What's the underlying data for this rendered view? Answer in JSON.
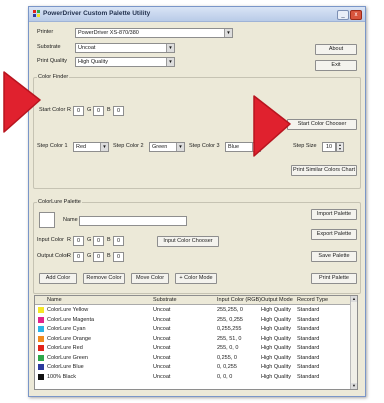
{
  "window": {
    "title": "PowerDriver Custom Palette Utility",
    "buttons": {
      "minimize": "_",
      "close": "x"
    }
  },
  "top": {
    "printer_label": "Printer",
    "printer_value": "PowerDriver XS-870/380",
    "substrate_label": "Substrate",
    "substrate_value": "Uncoat",
    "print_quality_label": "Print Quality",
    "print_quality_value": "High Quality",
    "about_button": "About",
    "exit_button": "Exit"
  },
  "color_finder": {
    "group_label": "Color Finder",
    "start_color_label": "Start Color",
    "r_label": "R",
    "g_label": "G",
    "b_label": "B",
    "start_r": "0",
    "start_g": "0",
    "start_b": "0",
    "start_chooser_button": "Start Color Chooser",
    "step1_label": "Step Color 1",
    "step1_value": "Red",
    "step2_label": "Step Color 2",
    "step2_value": "Green",
    "step3_label": "Step Color 3",
    "step3_value": "Blue",
    "step_size_label": "Step Size",
    "step_size_value": "10",
    "print_similar_button": "Print Similar Colors Chart"
  },
  "colorlure": {
    "group_label": "ColorLure Palette",
    "name_label": "Name",
    "name_value": "",
    "input_color_label": "Input Color",
    "output_color_label": "Output Color",
    "r_label": "R",
    "g_label": "G",
    "b_label": "B",
    "in_r": "0",
    "in_g": "0",
    "in_b": "0",
    "out_r": "0",
    "out_g": "0",
    "out_b": "0",
    "input_chooser_button": "Input Color Chooser",
    "import_button": "Import Palette",
    "export_button": "Export Palette",
    "save_button": "Save Palette",
    "print_button": "Print Palette",
    "add_button": "Add Color",
    "remove_button": "Remove Color",
    "move_button": "Move Color",
    "color_mode_button": "+ Color Mode"
  },
  "table": {
    "columns": [
      "Name",
      "Substrate",
      "Input Color (RGB)",
      "Output Mode",
      "Record Type"
    ],
    "rows": [
      {
        "swatch": "#f5e627",
        "cells": [
          "ColorLure Yellow",
          "Uncoat",
          "255,255, 0",
          "High Quality",
          "Standard"
        ]
      },
      {
        "swatch": "#e0248c",
        "cells": [
          "ColorLure Magenta",
          "Uncoat",
          "255, 0,255",
          "High Quality",
          "Standard"
        ]
      },
      {
        "swatch": "#2ab4e6",
        "cells": [
          "ColorLure Cyan",
          "Uncoat",
          "0,255,255",
          "High Quality",
          "Standard"
        ]
      },
      {
        "swatch": "#f08a1e",
        "cells": [
          "ColorLure Orange",
          "Uncoat",
          "255, 51, 0",
          "High Quality",
          "Standard"
        ]
      },
      {
        "swatch": "#e2231a",
        "cells": [
          "ColorLure Red",
          "Uncoat",
          "255, 0, 0",
          "High Quality",
          "Standard"
        ]
      },
      {
        "swatch": "#2da84a",
        "cells": [
          "ColorLure Green",
          "Uncoat",
          "0,255, 0",
          "High Quality",
          "Standard"
        ]
      },
      {
        "swatch": "#2b3a9e",
        "cells": [
          "ColorLure Blue",
          "Uncoat",
          "0, 0,255",
          "High Quality",
          "Standard"
        ]
      },
      {
        "swatch": "#111111",
        "cells": [
          "100% Black",
          "Uncoat",
          "0, 0, 0",
          "High Quality",
          "Standard"
        ]
      }
    ]
  },
  "colors": {
    "accent_red": "#e0212e",
    "titlebar": "#c9d7ee",
    "dialog": "#ece9d8"
  }
}
